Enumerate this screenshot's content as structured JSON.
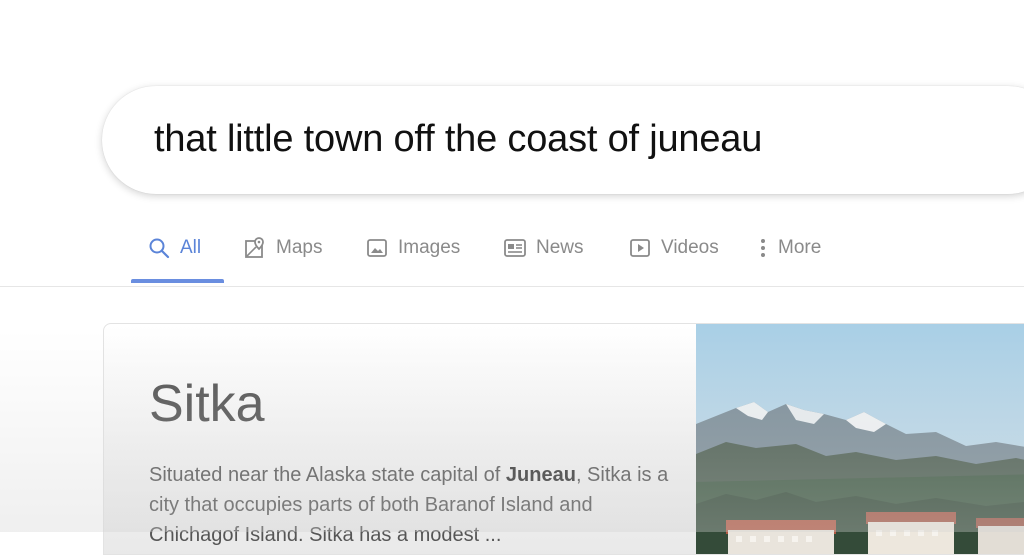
{
  "search": {
    "query": "that little town off the coast of juneau"
  },
  "tabs": [
    {
      "label": "All",
      "icon": "search-icon",
      "active": true
    },
    {
      "label": "Maps",
      "icon": "map-pin-icon",
      "active": false
    },
    {
      "label": "Images",
      "icon": "image-icon",
      "active": false
    },
    {
      "label": "News",
      "icon": "newspaper-icon",
      "active": false
    },
    {
      "label": "Videos",
      "icon": "play-video-icon",
      "active": false
    },
    {
      "label": "More",
      "icon": "more-vertical-icon",
      "active": false
    }
  ],
  "result": {
    "title": "Sitka",
    "desc_before": "Situated near the Alaska state capital of ",
    "desc_bold": "Juneau",
    "desc_after": ", Sitka is a city that occupies parts of both Baranof Island and Chichagof Island. Sitka has a modest ..."
  },
  "colors": {
    "accent": "#5b84d8",
    "tab_inactive": "#8a8a8a",
    "title": "#555555"
  }
}
